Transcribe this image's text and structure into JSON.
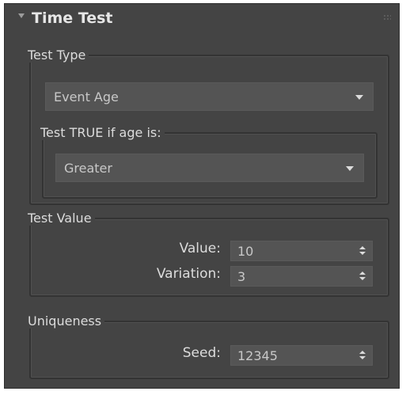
{
  "rollout": {
    "title": "Time Test"
  },
  "test_type": {
    "legend": "Test Type",
    "selected": "Event Age",
    "condition": {
      "legend": "Test TRUE if age is:",
      "selected": "Greater"
    }
  },
  "test_value": {
    "legend": "Test Value",
    "value_label": "Value:",
    "value": "10",
    "variation_label": "Variation:",
    "variation": "3"
  },
  "uniqueness": {
    "legend": "Uniqueness",
    "seed_label": "Seed:",
    "seed": "12345"
  },
  "icons": {
    "collapse": "chevron-down-icon",
    "grip": "drag-grip-icon",
    "dropdown": "dropdown-arrow-icon",
    "spinner": "spinner-arrows-icon"
  },
  "colors": {
    "panel_bg": "#444444",
    "field_bg": "#545454",
    "text": "#dcdcdc"
  }
}
